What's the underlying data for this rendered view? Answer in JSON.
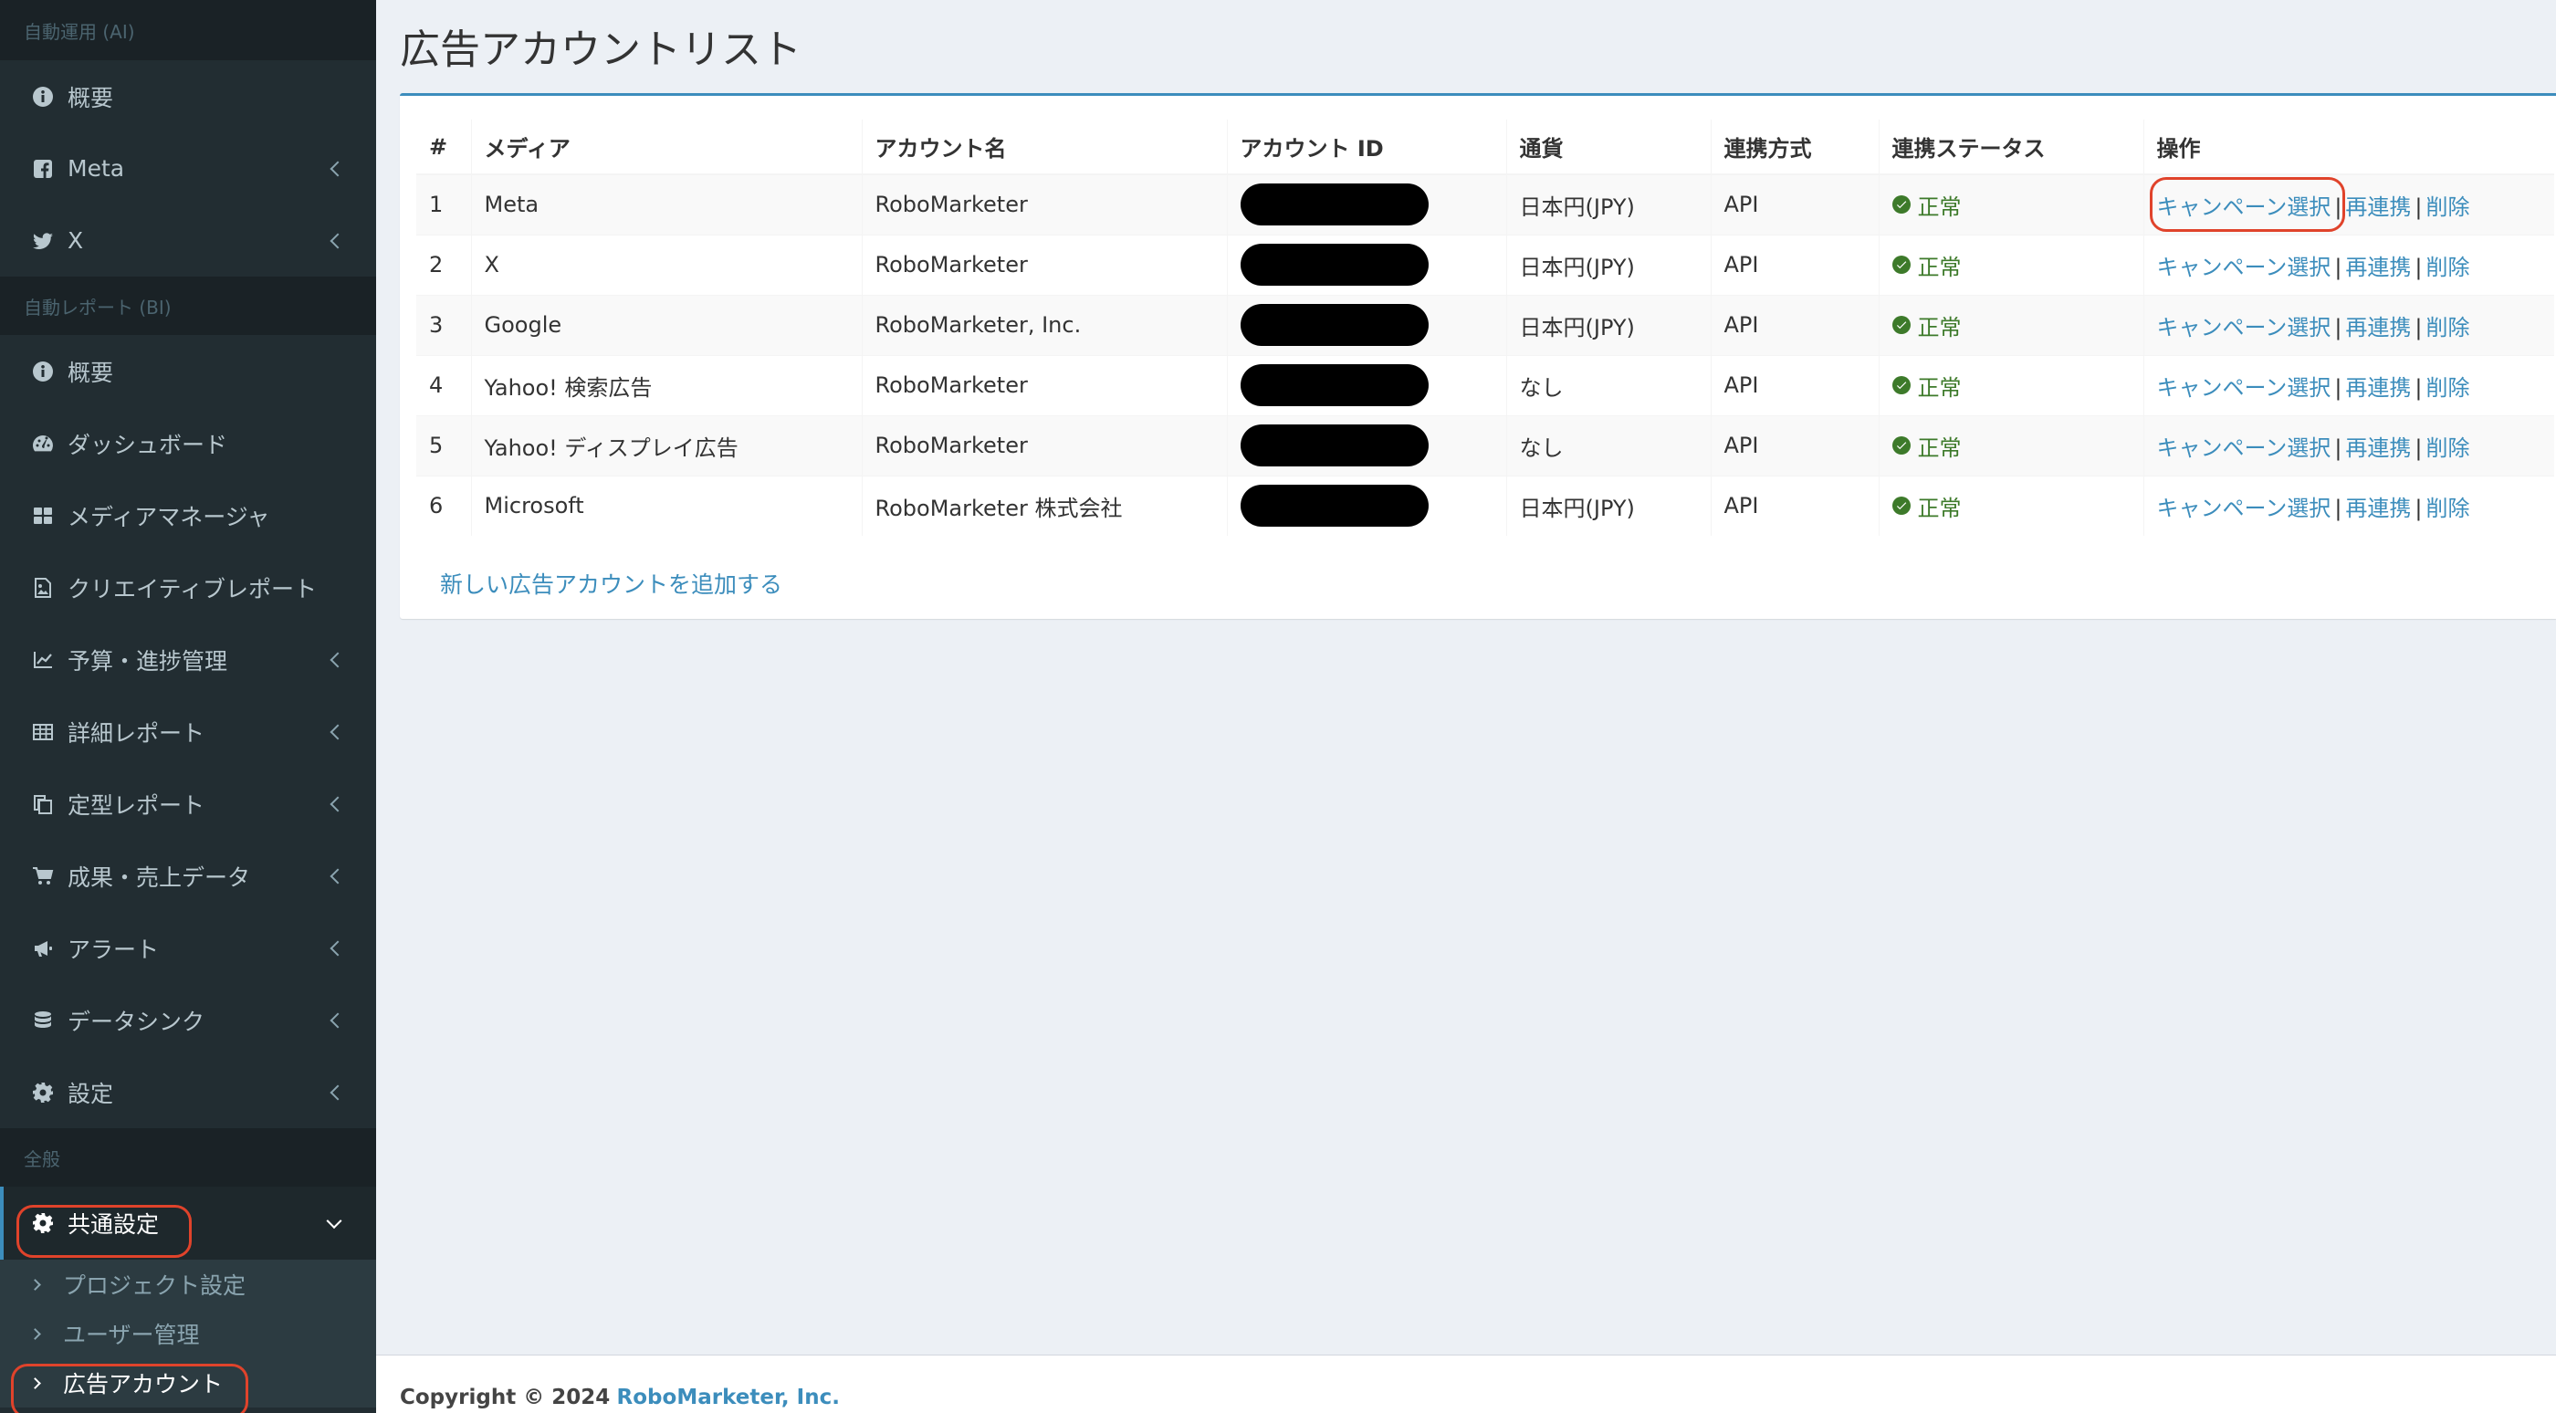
{
  "sidebar": {
    "section_auto_ops": "自動運用 (AI)",
    "section_auto_report": "自動レポート (BI)",
    "section_general": "全般",
    "items_ai": [
      {
        "label": "概要",
        "icon": "info-icon"
      },
      {
        "label": "Meta",
        "icon": "facebook-icon"
      },
      {
        "label": "X",
        "icon": "twitter-icon"
      }
    ],
    "items_bi": [
      {
        "label": "概要",
        "icon": "info-icon"
      },
      {
        "label": "ダッシュボード",
        "icon": "dashboard-icon"
      },
      {
        "label": "メディアマネージャ",
        "icon": "grid-icon"
      },
      {
        "label": "クリエイティブレポート",
        "icon": "image-icon"
      },
      {
        "label": "予算・進捗管理",
        "icon": "line-chart-icon"
      },
      {
        "label": "詳細レポート",
        "icon": "table-icon"
      },
      {
        "label": "定型レポート",
        "icon": "copy-icon"
      },
      {
        "label": "成果・売上データ",
        "icon": "cart-icon"
      },
      {
        "label": "アラート",
        "icon": "bullhorn-icon"
      },
      {
        "label": "データシンク",
        "icon": "database-icon"
      },
      {
        "label": "設定",
        "icon": "gear-icon"
      }
    ],
    "common_settings": {
      "label": "共通設定",
      "icon": "gear-icon"
    },
    "sub_items": [
      {
        "label": "プロジェクト設定"
      },
      {
        "label": "ユーザー管理"
      },
      {
        "label": "広告アカウント"
      }
    ]
  },
  "main": {
    "title": "広告アカウントリスト",
    "columns": [
      "#",
      "メディア",
      "アカウント名",
      "アカウント ID",
      "通貨",
      "連携方式",
      "連携ステータス",
      "操作"
    ],
    "rows": [
      {
        "num": "1",
        "media": "Meta",
        "account": "RoboMarketer",
        "currency": "日本円(JPY)",
        "method": "API",
        "status": "正常"
      },
      {
        "num": "2",
        "media": "X",
        "account": "RoboMarketer",
        "currency": "日本円(JPY)",
        "method": "API",
        "status": "正常"
      },
      {
        "num": "3",
        "media": "Google",
        "account": "RoboMarketer, Inc.",
        "currency": "日本円(JPY)",
        "method": "API",
        "status": "正常"
      },
      {
        "num": "4",
        "media": "Yahoo! 検索広告",
        "account": "RoboMarketer",
        "currency": "なし",
        "method": "API",
        "status": "正常"
      },
      {
        "num": "5",
        "media": "Yahoo! ディスプレイ広告",
        "account": "RoboMarketer",
        "currency": "なし",
        "method": "API",
        "status": "正常"
      },
      {
        "num": "6",
        "media": "Microsoft",
        "account": "RoboMarketer 株式会社",
        "currency": "日本円(JPY)",
        "method": "API",
        "status": "正常"
      }
    ],
    "actions": {
      "campaign": "キャンペーン選択",
      "relink": "再連携",
      "delete": "削除",
      "sep": "|"
    },
    "add_link": "新しい広告アカウントを追加する"
  },
  "footer": {
    "copyright": "Copyright © 2024",
    "company": "RoboMarketer, Inc."
  },
  "colors": {
    "sidebar_bg": "#222d32",
    "accent": "#3c8dbc",
    "status_ok": "#3d7a2a",
    "highlight": "#e0432b"
  }
}
